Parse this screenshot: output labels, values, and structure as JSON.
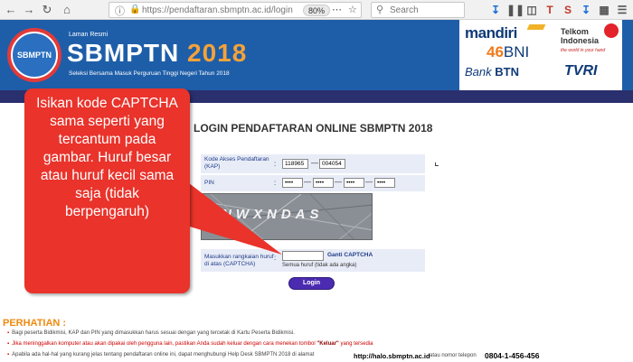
{
  "browser": {
    "url": "https://pendaftaran.sbmptn.ac.id/login",
    "zoom": "80%",
    "search_placeholder": "Search",
    "icons": [
      "back-arrow-icon",
      "forward-arrow-icon",
      "reload-icon",
      "home-icon",
      "info-icon",
      "lock-icon",
      "page-actions-icon",
      "bookmark-star-icon",
      "search-icon",
      "download-icon",
      "library-icon",
      "sidebar-icon",
      "tool-t-icon",
      "tool-s-icon",
      "menu-icon"
    ]
  },
  "header": {
    "laman": "Laman Resmi",
    "logo_text": "SBMPTN",
    "brand": "SBMPTN",
    "brand_year": "2018",
    "subtitle": "Seleksi Bersama Masuk Perguruan Tinggi Negeri Tahun 2018",
    "sponsors": {
      "mandiri": "mandiri",
      "bni": "BNI",
      "bni_mark": "46",
      "btn_prefix": "Bank",
      "btn": "BTN",
      "telkom": "Telkom",
      "indonesia": "Indonesia",
      "telkom_tagline": "the world in your hand",
      "tvri": "TVRI"
    }
  },
  "callout": {
    "text": "Isikan kode CAPTCHA sama seperti yang tercantum pada gambar. Huruf besar atau huruf kecil sama saja (tidak berpengaruh)"
  },
  "login": {
    "title": "LOGIN PENDAFTARAN ONLINE SBMPTN 2018",
    "kap_label": "Kode Akses Pendaftaran (KAP)",
    "kap_1": "118965",
    "kap_2": "004054",
    "pin_label": "PIN",
    "pin_1": "••••",
    "pin_2": "••••",
    "pin_3": "••••",
    "pin_4": "••••",
    "captcha_image_text": "NWXNDAS",
    "captcha_label": "Masukkan rangkaian huruf di atas (CAPTCHA)",
    "captcha_value": "",
    "ganti": "Ganti CAPTCHA",
    "hint": "Semua huruf (tidak ada angka)",
    "separator": ":",
    "dash": "—",
    "button": "Login"
  },
  "notes": {
    "heading": "PERHATIAN :",
    "bullet": "▪",
    "items": [
      "Bagi peserta Bidikmisi, KAP dan PIN yang dimasukkan harus sesuai dengan yang tercetak di Kartu Peserta Bidikmisi.",
      "Jika meninggalkan komputer atau akan dipakai oleh pengguna lain, pastikan Anda sudah keluar dengan cara menekan tombol",
      "Apabila ada hal-hal yang kurang jelas tentang pendaftaran online ini, dapat menghubungi Help Desk SBMPTN 2018 di alamat"
    ],
    "keluar": "\"Keluar\"",
    "keluar_tail": "yang tersedia",
    "help_url": "http://halo.sbmptn.ac.id",
    "help_tail": "atau nomor telepon",
    "phone": "0804-1-456-456"
  },
  "colors": {
    "header_blue": "#1e5ea8",
    "stripe_navy": "#2a2f6e",
    "callout_red": "#e9332b",
    "accent_orange": "#f08a10",
    "button_purple": "#4b2bb0"
  }
}
